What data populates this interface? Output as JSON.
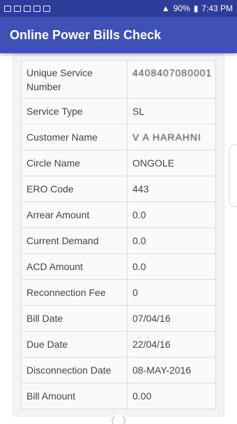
{
  "status_bar": {
    "battery": "90%",
    "time": "7:43 PM"
  },
  "app_bar": {
    "title": "Online Power Bills Check"
  },
  "rows": [
    {
      "label": "Unique Service Number",
      "value": "4408407080001"
    },
    {
      "label": "Service Type",
      "value": "SL"
    },
    {
      "label": "Customer Name",
      "value": "V A HARAHNI"
    },
    {
      "label": "Circle Name",
      "value": "ONGOLE"
    },
    {
      "label": "ERO Code",
      "value": "443"
    },
    {
      "label": "Arrear Amount",
      "value": "0.0"
    },
    {
      "label": "Current Demand",
      "value": "0.0"
    },
    {
      "label": "ACD Amount",
      "value": "0.0"
    },
    {
      "label": "Reconnection Fee",
      "value": "0"
    },
    {
      "label": "Bill Date",
      "value": "07/04/16"
    },
    {
      "label": "Due Date",
      "value": "22/04/16"
    },
    {
      "label": "Disconnection Date",
      "value": "08-MAY-2016"
    },
    {
      "label": "Bill Amount",
      "value": "0.00"
    }
  ]
}
